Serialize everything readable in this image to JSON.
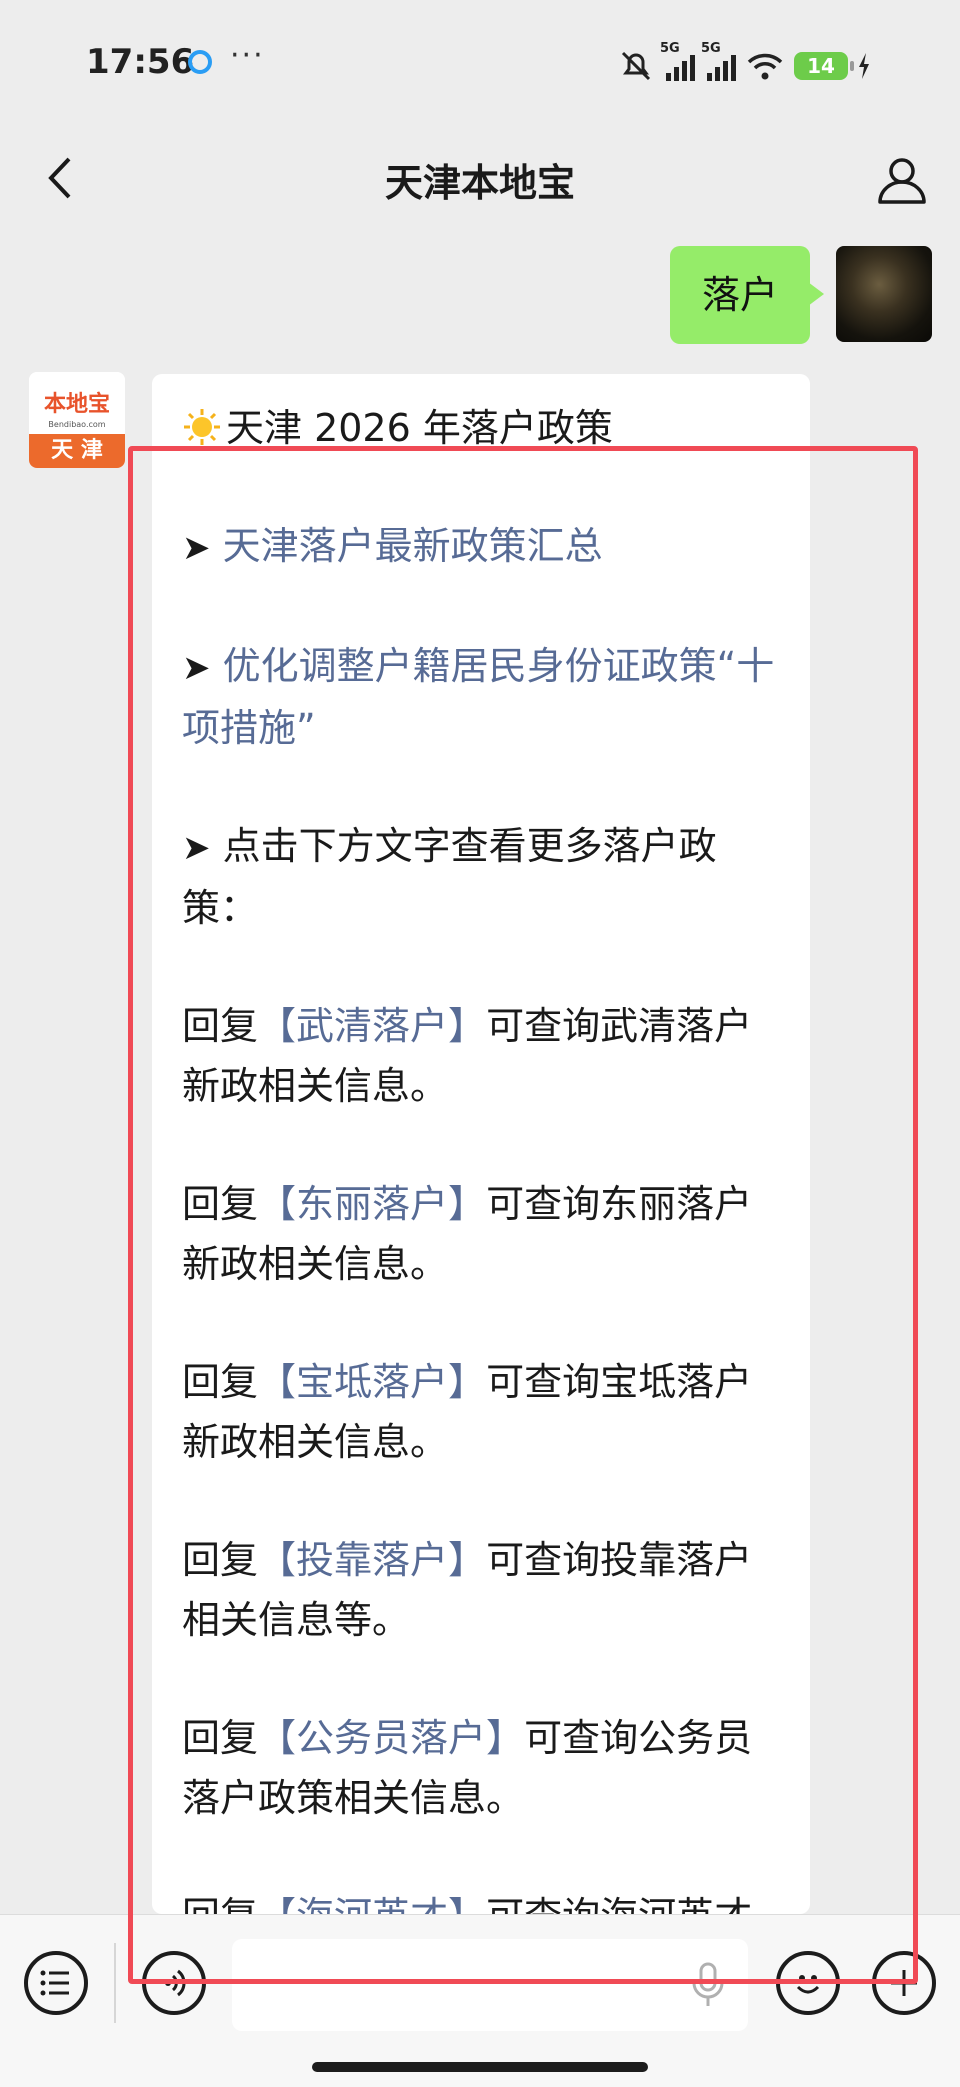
{
  "status_bar": {
    "time": "17:56",
    "more": "···",
    "net1": "5G",
    "net2": "5G",
    "battery": "14"
  },
  "header": {
    "title": "天津本地宝"
  },
  "messages": {
    "user_text": "落户",
    "bot_avatar_brand": "本地宝",
    "bot_avatar_site": "Bendibao.com",
    "bot_avatar_city": "天 津",
    "title": "天津 2026 年落户政策",
    "arrow": "➤",
    "link1": "天津落户最新政策汇总",
    "link2": "优化调整户籍居民身份证政策“十项措施”",
    "tip": "点击下方文字查看更多落户政策：",
    "reply_prefix": "回复",
    "bracket_open": "【",
    "bracket_close": "】",
    "replies": [
      {
        "keyword": "武清落户",
        "desc": "可查询武清落户新政相关信息。"
      },
      {
        "keyword": "东丽落户",
        "desc": "可查询东丽落户新政相关信息。"
      },
      {
        "keyword": "宝坻落户",
        "desc": "可查询宝坻落户新政相关信息。"
      },
      {
        "keyword": "投靠落户",
        "desc": "可查询投靠落户相关信息等。"
      },
      {
        "keyword": "公务员落户",
        "desc": "可查询公务员落户政策相关信息。"
      },
      {
        "keyword": "海河英才",
        "desc": "可查询海河英才"
      }
    ]
  },
  "colors": {
    "link": "#576b95",
    "user_bubble": "#95ec69",
    "highlight_box": "#f04a55"
  }
}
